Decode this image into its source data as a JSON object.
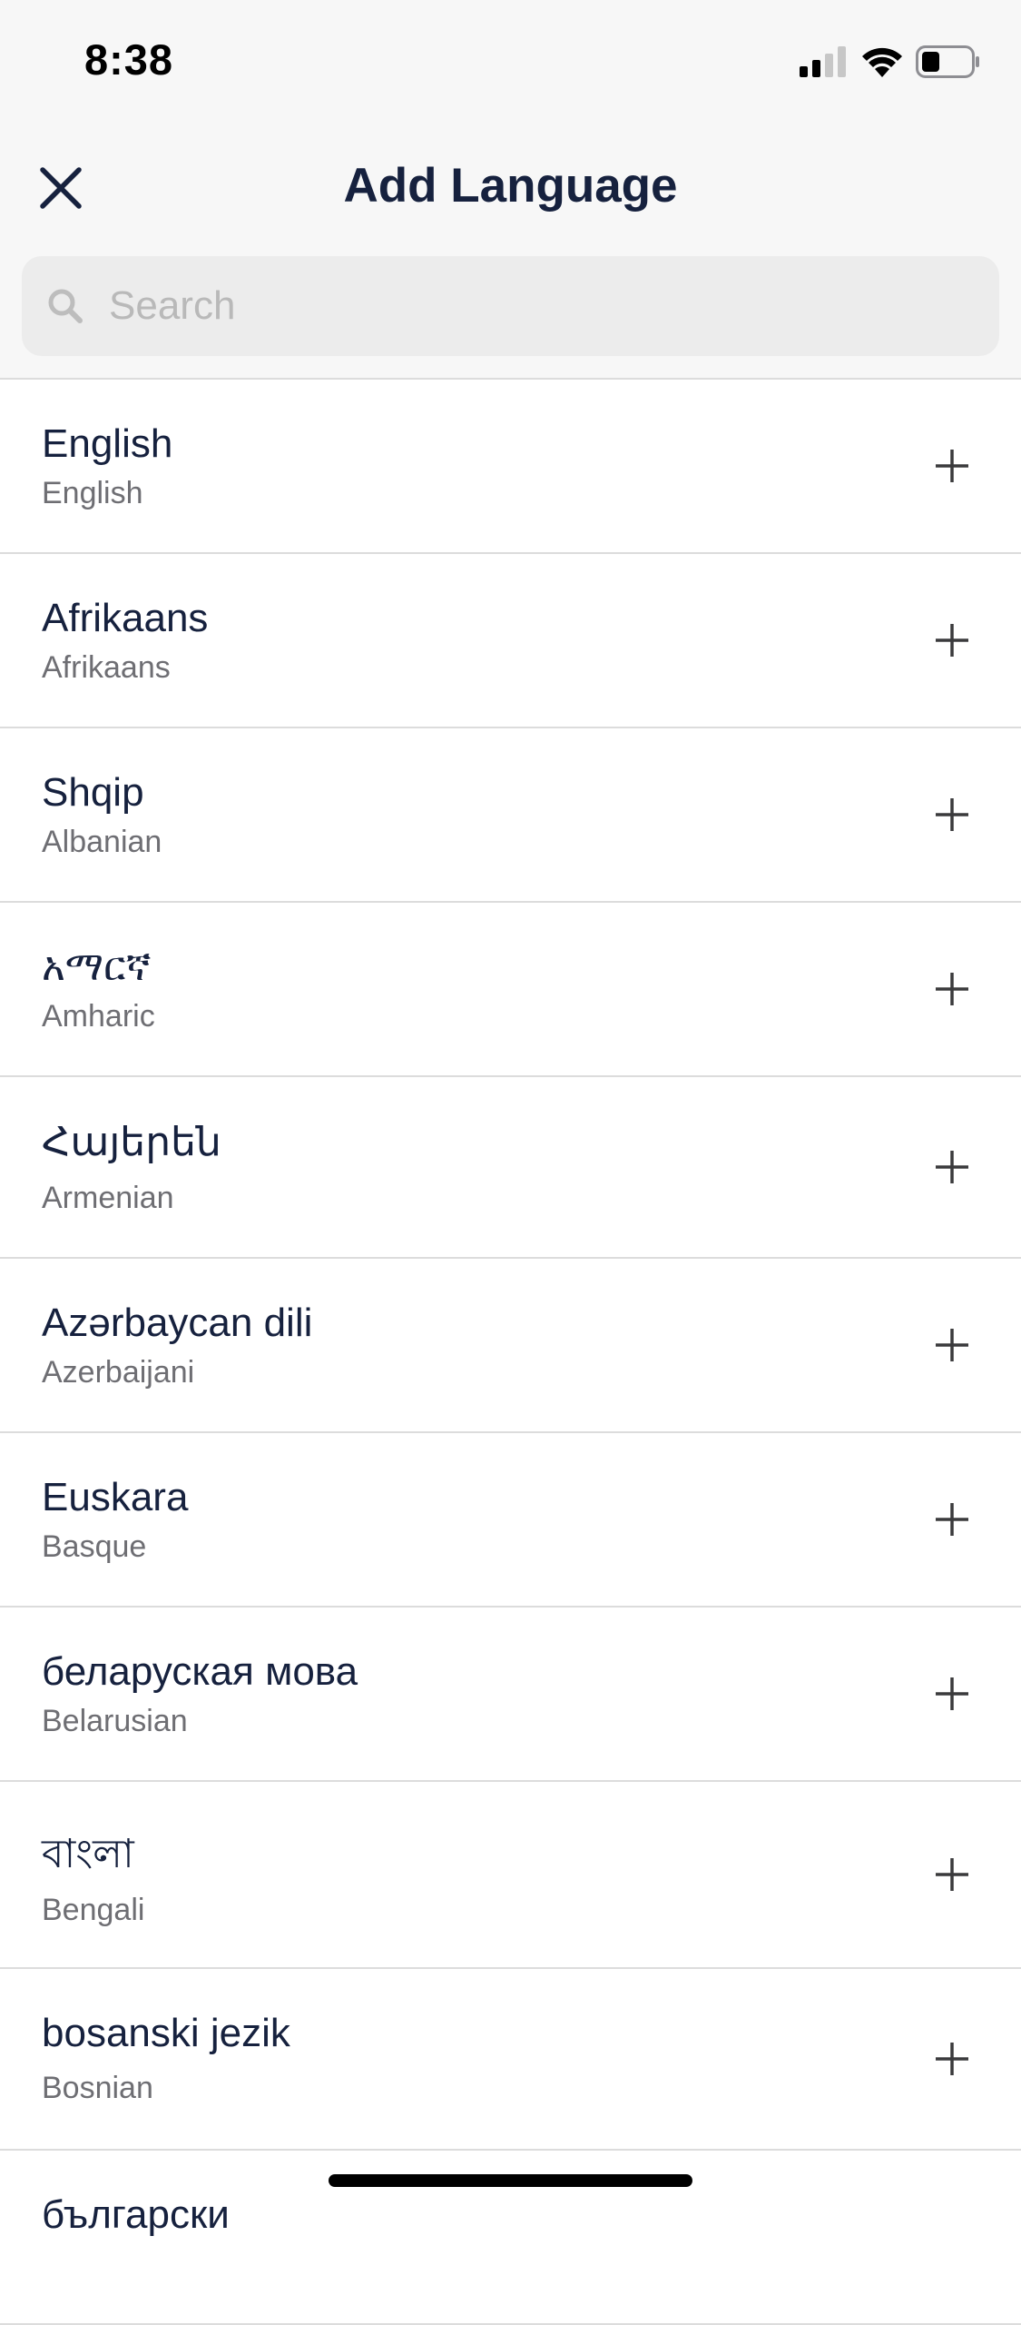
{
  "status_bar": {
    "time": "8:38"
  },
  "header": {
    "title": "Add Language"
  },
  "search": {
    "placeholder": "Search",
    "value": ""
  },
  "languages": [
    {
      "native": "English",
      "english": "English"
    },
    {
      "native": "Afrikaans",
      "english": "Afrikaans"
    },
    {
      "native": "Shqip",
      "english": "Albanian"
    },
    {
      "native": "አማርኛ",
      "english": "Amharic"
    },
    {
      "native": "Հայերեն",
      "english": "Armenian"
    },
    {
      "native": "Azərbaycan dili",
      "english": "Azerbaijani"
    },
    {
      "native": "Euskara",
      "english": "Basque"
    },
    {
      "native": "беларуская мова",
      "english": "Belarusian"
    },
    {
      "native": "বাংলা",
      "english": "Bengali"
    },
    {
      "native": "bosanski jezik",
      "english": "Bosnian"
    },
    {
      "native": "български",
      "english": ""
    }
  ],
  "colors": {
    "title": "#16213e",
    "secondary_text": "#6e6e73",
    "divider": "#dcdcdc",
    "header_bg": "#f7f7f7",
    "search_bg": "#ececec"
  },
  "icons": {
    "close": "close-icon",
    "search": "search-icon",
    "add": "plus-icon",
    "signal": "cellular-signal-icon",
    "wifi": "wifi-icon",
    "battery": "battery-icon"
  }
}
